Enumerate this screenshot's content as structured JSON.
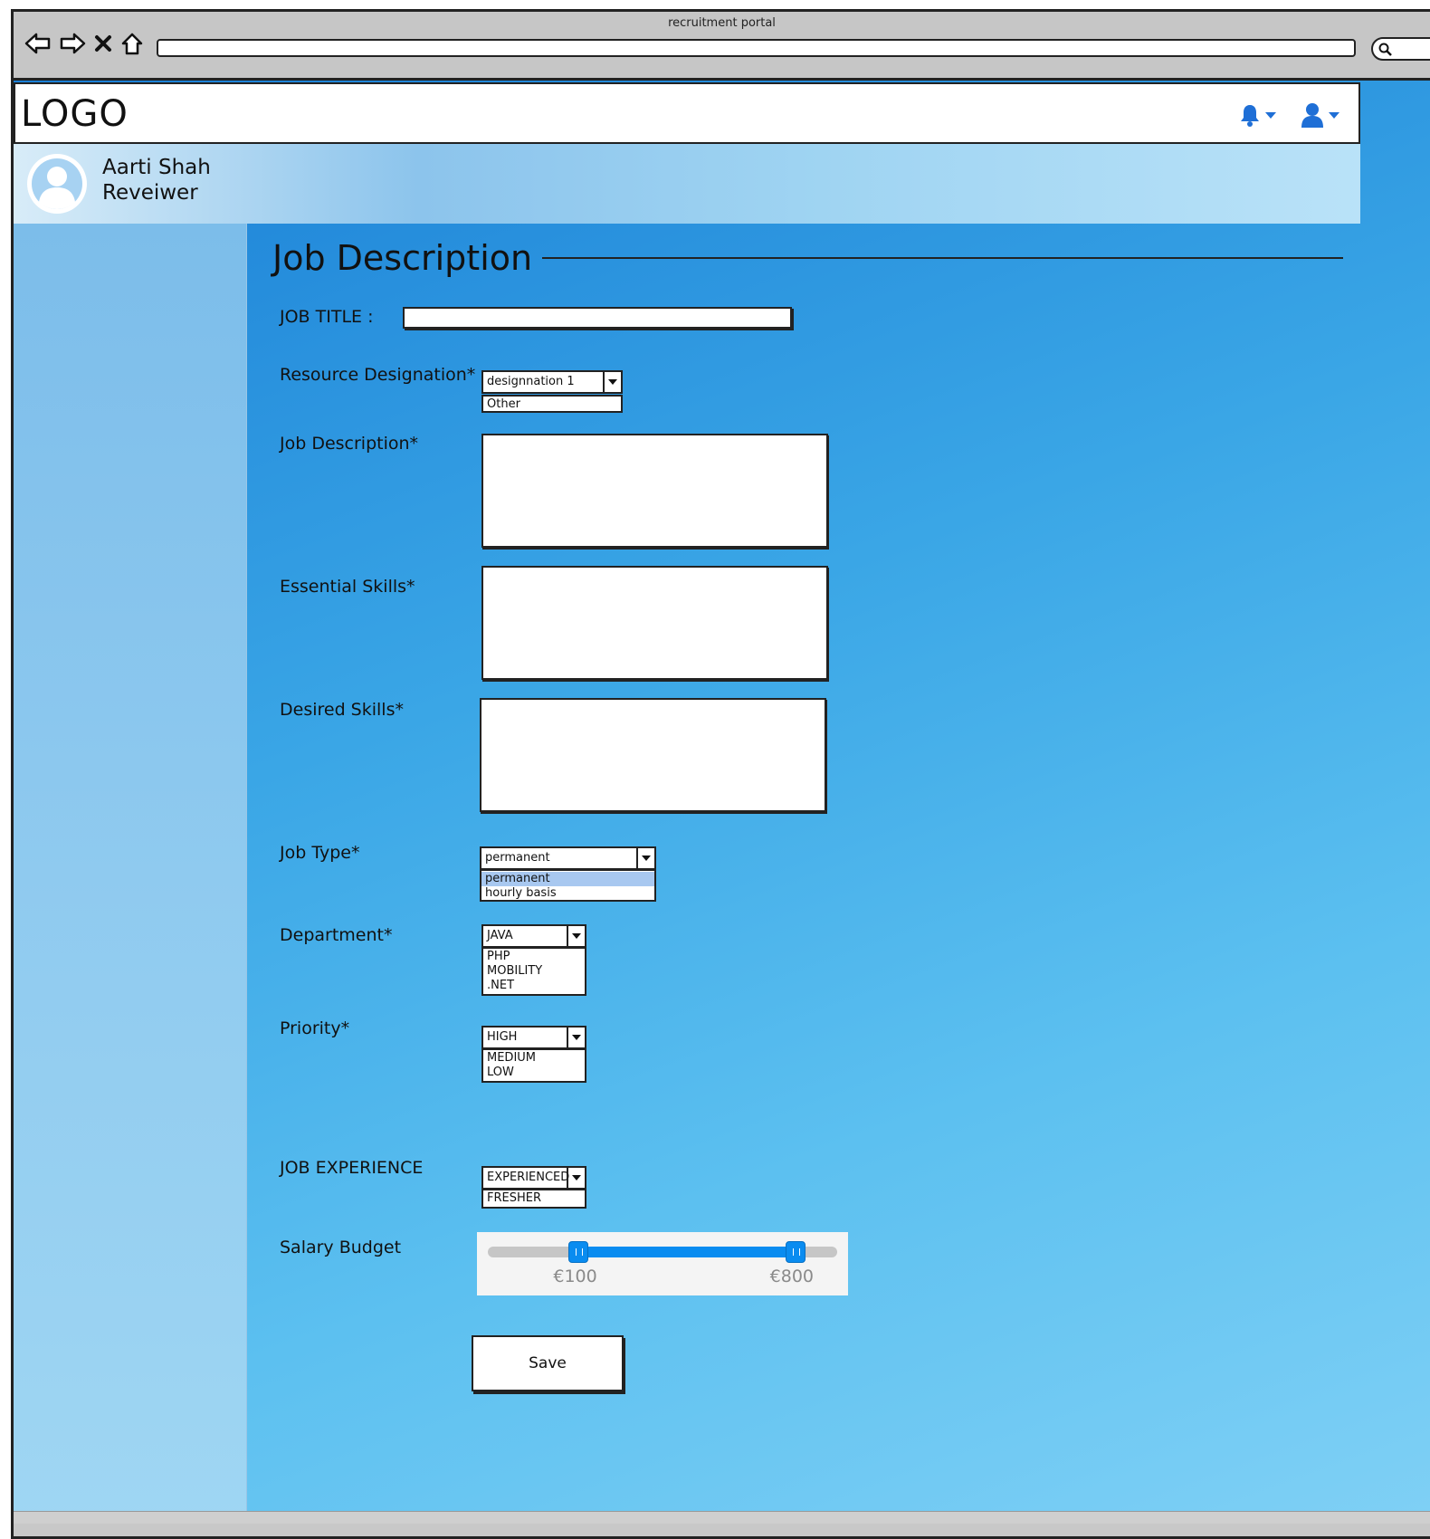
{
  "browser": {
    "title": "recruitment portal"
  },
  "header": {
    "logo": "LOGO"
  },
  "user": {
    "name": "Aarti Shah",
    "role": "Reveiwer"
  },
  "page": {
    "title": "Job Description"
  },
  "form": {
    "job_title": {
      "label": "JOB TITLE :",
      "value": ""
    },
    "resource_designation": {
      "label": "Resource Designation*",
      "selected": "designnation 1",
      "options": [
        "Other"
      ]
    },
    "job_description": {
      "label": "Job Description*",
      "value": ""
    },
    "essential_skills": {
      "label": "Essential Skills*",
      "value": ""
    },
    "desired_skills": {
      "label": "Desired Skills*",
      "value": ""
    },
    "job_type": {
      "label": "Job Type*",
      "selected": "permanent",
      "options": [
        "permanent",
        "hourly basis"
      ]
    },
    "department": {
      "label": "Department*",
      "selected": "JAVA",
      "options": [
        "PHP",
        "MOBILITY",
        ".NET"
      ]
    },
    "priority": {
      "label": "Priority*",
      "selected": "HIGH",
      "options": [
        "MEDIUM",
        "LOW"
      ]
    },
    "job_experience": {
      "label": "JOB EXPERIENCE",
      "selected": "EXPERIENCED",
      "options": [
        "FRESHER"
      ]
    },
    "salary_budget": {
      "label": "Salary Budget",
      "min_label": "€100",
      "max_label": "€800",
      "range_start": 0.26,
      "range_end": 0.88
    },
    "save_label": "Save"
  },
  "colors": {
    "accent": "#0a8cf0",
    "header_icons": "#1f6fd6"
  }
}
